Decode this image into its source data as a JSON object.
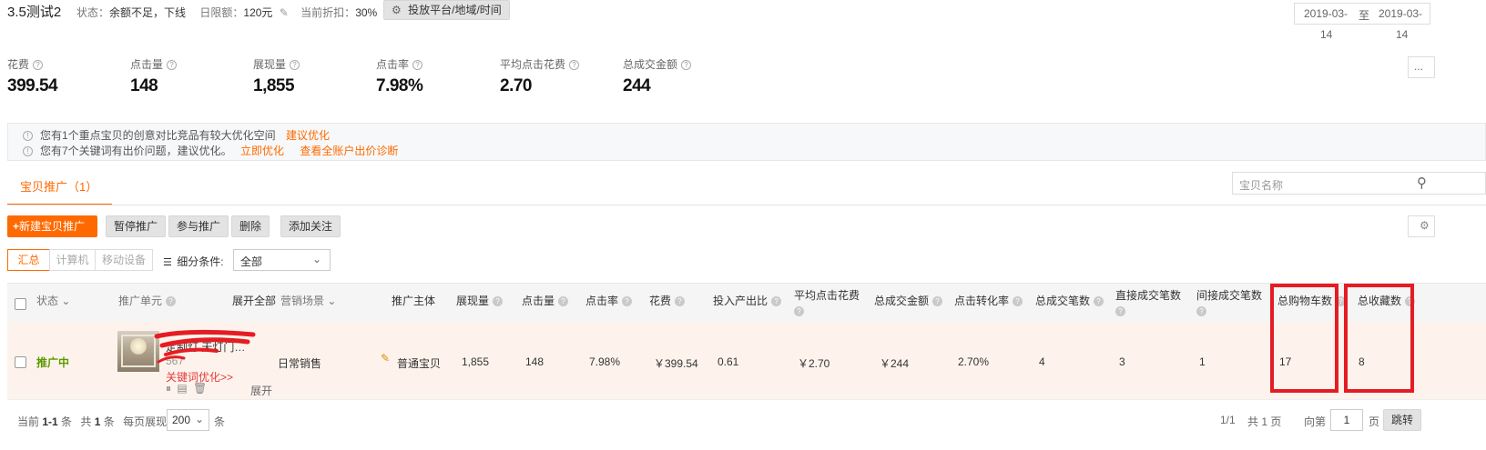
{
  "header": {
    "title": "3.5测试2",
    "status_label": "状态：",
    "status_value": "余额不足，下线",
    "budget_label": "日限额：",
    "budget_value": "120元",
    "discount_label": "当前折扣：",
    "discount_value": "30%",
    "platform_button": "投放平台/地域/时间"
  },
  "date_range": {
    "start_line1": "2019-03-",
    "start_line2": "14",
    "separator": "至",
    "end_line1": "2019-03-",
    "end_line2": "14"
  },
  "more_button": "...",
  "metrics": [
    {
      "label": "花费",
      "value": "399.54"
    },
    {
      "label": "点击量",
      "value": "148"
    },
    {
      "label": "展现量",
      "value": "1,855"
    },
    {
      "label": "点击率",
      "value": "7.98%"
    },
    {
      "label": "平均点击花费",
      "value": "2.70"
    },
    {
      "label": "总成交金额",
      "value": "244"
    }
  ],
  "notices": [
    {
      "text": "您有1个重点宝贝的创意对比竞品有较大优化空间",
      "links": [
        "建议优化"
      ]
    },
    {
      "text": "您有7个关键词有出价问题，建议优化。",
      "links": [
        "立即优化",
        "查看全账户出价诊断"
      ]
    }
  ],
  "tab": {
    "label": "宝贝推广（1）"
  },
  "search": {
    "placeholder": "宝贝名称"
  },
  "toolbar": {
    "new_button": "新建宝贝推广",
    "pause_button": "暂停推广",
    "join_button": "参与推广",
    "delete_button": "删除",
    "follow_button": "添加关注"
  },
  "device_tabs": [
    "汇总",
    "计算机",
    "移动设备"
  ],
  "filter": {
    "label": "细分条件:",
    "value": "全部"
  },
  "table": {
    "headers": {
      "status": "状态",
      "unit": "推广单元",
      "expand_all": "展开全部",
      "scene": "营销场景",
      "subject": "推广主体",
      "impressions": "展现量",
      "clicks": "点击量",
      "ctr": "点击率",
      "cost": "花费",
      "roi": "投入产出比",
      "cpc": "平均点击花费",
      "gmv": "总成交金额",
      "cvr": "点击转化率",
      "orders": "总成交笔数",
      "direct_orders": "直接成交笔数",
      "indirect_orders": "间接成交笔数",
      "cart": "总购物车数",
      "fav": "总收藏数"
    },
    "row": {
      "status": "推广中",
      "title": "定制灯 天灯门…",
      "id_partial": "567",
      "keyword_link": "关键词优化>>",
      "expand": "展开",
      "scene": "日常销售",
      "subject": "普通宝贝",
      "impressions": "1,855",
      "clicks": "148",
      "ctr": "7.98%",
      "cost": "￥399.54",
      "roi": "0.61",
      "cpc": "￥2.70",
      "gmv": "￥244",
      "cvr": "2.70%",
      "orders": "4",
      "direct_orders": "3",
      "indirect_orders": "1",
      "cart": "17",
      "fav": "8"
    }
  },
  "pagination": {
    "current_prefix": "当前",
    "current_range": "1-1",
    "unit": "条",
    "total_prefix": "共",
    "total_count": "1",
    "per_page_label": "每页展现",
    "per_page_value": "200",
    "page_info": "1/1",
    "total_pages_prefix": "共",
    "total_pages": "1",
    "pages_unit": "页",
    "goto_prefix": "向第",
    "goto_value": "1",
    "goto_suffix": "页",
    "goto_button": "跳转"
  },
  "colors": {
    "accent": "#ff6a00",
    "status_green": "#5a9a00",
    "row_bg": "#fdf3ec",
    "header_bg": "#f5f5f5",
    "annotation_red": "#e51c23"
  }
}
